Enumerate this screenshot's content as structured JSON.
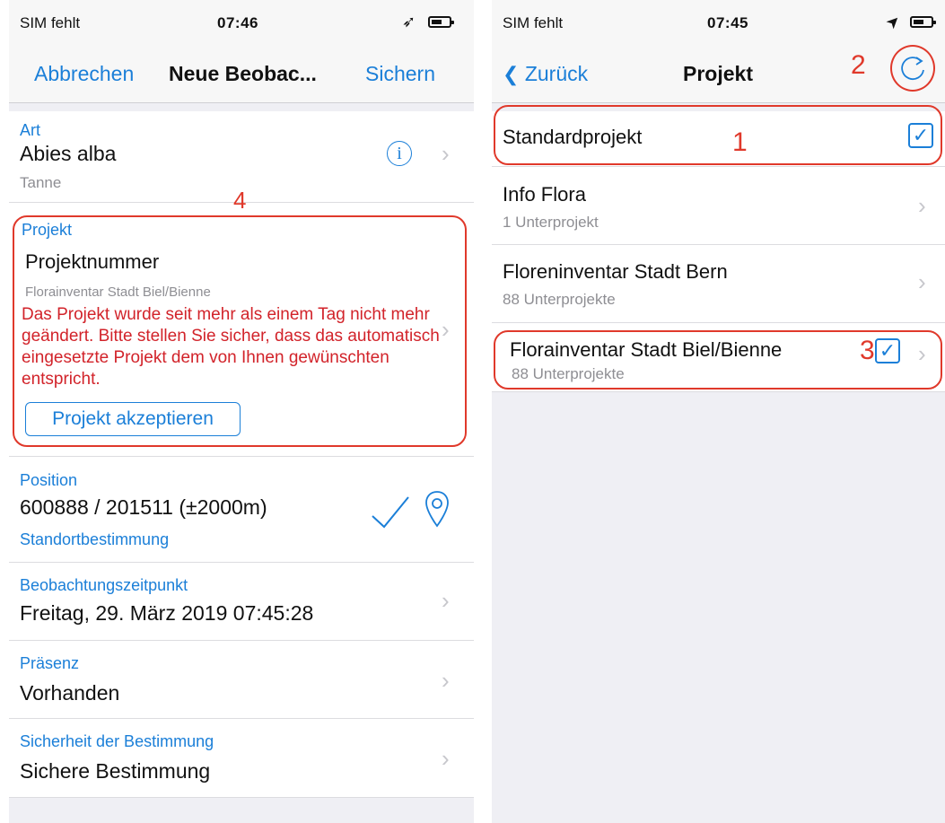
{
  "left": {
    "status": {
      "carrier": "SIM fehlt",
      "time": "07:46",
      "location_glyph": "➶",
      "battery_icon": "battery-icon"
    },
    "nav": {
      "cancel": "Abbrechen",
      "title": "Neue Beobac...",
      "save": "Sichern"
    },
    "art": {
      "label": "Art",
      "value": "Abies alba",
      "sub": "Tanne",
      "info_glyph": "i",
      "chevron": "›"
    },
    "projekt": {
      "label": "Projekt",
      "value": "Projektnummer",
      "sub": "Florainventar Stadt Biel/Bienne",
      "warning": "Das Projekt wurde seit mehr als einem Tag nicht mehr geändert. Bitte stellen Sie sicher, dass das automatisch eingesetzte Projekt dem von Ihnen gewünschten entspricht.",
      "accept_button": "Projekt akzeptieren",
      "chevron": "›",
      "annotation_number": "4"
    },
    "position": {
      "label": "Position",
      "value": "600888 / 201511 (±2000m)",
      "sub": "Standortbestimmung"
    },
    "zeitpunkt": {
      "label": "Beobachtungszeitpunkt",
      "value": "Freitag, 29. März 2019 07:45:28",
      "chevron": "›"
    },
    "praesenz": {
      "label": "Präsenz",
      "value": "Vorhanden",
      "chevron": "›"
    },
    "sicherheit": {
      "label": "Sicherheit der Bestimmung",
      "value": "Sichere Bestimmung",
      "chevron": "›"
    }
  },
  "right": {
    "status": {
      "carrier": "SIM fehlt",
      "time": "07:45",
      "location_glyph": "➤",
      "battery_icon": "battery-icon"
    },
    "nav": {
      "back_glyph": "❮",
      "back": "Zurück",
      "title": "Projekt",
      "annotation_number": "2"
    },
    "projects": [
      {
        "name": "Standardprojekt",
        "sub": "",
        "checked": true,
        "annotation_number": "1"
      },
      {
        "name": "Info Flora",
        "sub": "1 Unterprojekt",
        "chevron": "›"
      },
      {
        "name": "Floreninventar Stadt Bern",
        "sub": "88 Unterprojekte",
        "chevron": "›"
      },
      {
        "name": "Florainventar Stadt Biel/Bienne",
        "sub": "88 Unterprojekte",
        "checked": true,
        "chevron": "›",
        "annotation_number": "3"
      }
    ],
    "check_glyph": "✓"
  },
  "colors": {
    "accent": "#1b7fd8",
    "warning": "#d2232a",
    "annotation": "#e0392b",
    "background": "#efeff4"
  }
}
